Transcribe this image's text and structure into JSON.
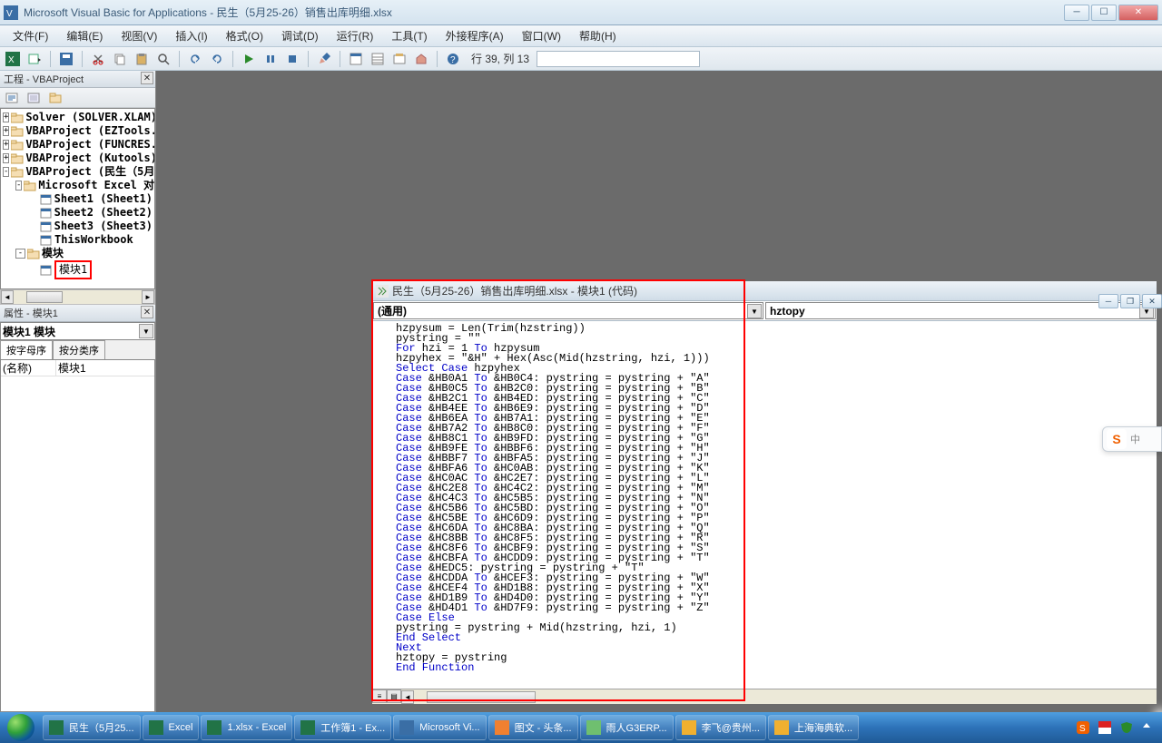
{
  "title": "Microsoft Visual Basic for Applications - 民生（5月25-26）销售出库明细.xlsx",
  "menus": [
    "文件(F)",
    "编辑(E)",
    "视图(V)",
    "插入(I)",
    "格式(O)",
    "调试(D)",
    "运行(R)",
    "工具(T)",
    "外接程序(A)",
    "窗口(W)",
    "帮助(H)"
  ],
  "cursorpos": "行 39, 列 13",
  "project_panel_title": "工程 - VBAProject",
  "tree": [
    {
      "lvl": 0,
      "toggle": "+",
      "label": "Solver (SOLVER.XLAM)"
    },
    {
      "lvl": 0,
      "toggle": "+",
      "label": "VBAProject (EZTools."
    },
    {
      "lvl": 0,
      "toggle": "+",
      "label": "VBAProject (FUNCRES."
    },
    {
      "lvl": 0,
      "toggle": "+",
      "label": "VBAProject (Kutools)"
    },
    {
      "lvl": 0,
      "toggle": "-",
      "label": "VBAProject (民生（5月"
    },
    {
      "lvl": 1,
      "toggle": "-",
      "label": "Microsoft Excel 对象"
    },
    {
      "lvl": 2,
      "toggle": "",
      "label": "Sheet1 (Sheet1)"
    },
    {
      "lvl": 2,
      "toggle": "",
      "label": "Sheet2 (Sheet2)"
    },
    {
      "lvl": 2,
      "toggle": "",
      "label": "Sheet3 (Sheet3)"
    },
    {
      "lvl": 2,
      "toggle": "",
      "label": "ThisWorkbook"
    },
    {
      "lvl": 1,
      "toggle": "-",
      "label": "模块"
    },
    {
      "lvl": 2,
      "toggle": "",
      "label": "模块1",
      "hl": true
    }
  ],
  "props_panel_title": "属性 - 模块1",
  "props_dd": "模块1 模块",
  "props_tabs": [
    "按字母序",
    "按分类序"
  ],
  "prop_row": {
    "k": "(名称)",
    "v": "模块1"
  },
  "codewin_title": "民生（5月25-26）销售出库明细.xlsx - 模块1 (代码)",
  "combo_left": "(通用)",
  "combo_right": "hztopy",
  "code_lines": [
    {
      "t": "hzpysum = Len(Trim(hzstring))"
    },
    {
      "t": "pystring = \"\""
    },
    {
      "k": "For",
      "t": " hzi = 1 ",
      "k2": "To",
      "t2": " hzpysum"
    },
    {
      "t": "hzpyhex = \"&H\" + Hex(Asc(Mid(hzstring, hzi, 1)))"
    },
    {
      "k": "Select Case",
      "t": " hzpyhex"
    },
    {
      "k": "Case",
      "t": " &HB0A1 ",
      "k2": "To",
      "t2": " &HB0C4: pystring = pystring + \"A\""
    },
    {
      "k": "Case",
      "t": " &HB0C5 ",
      "k2": "To",
      "t2": " &HB2C0: pystring = pystring + \"B\""
    },
    {
      "k": "Case",
      "t": " &HB2C1 ",
      "k2": "To",
      "t2": " &HB4ED: pystring = pystring + \"C\""
    },
    {
      "k": "Case",
      "t": " &HB4EE ",
      "k2": "To",
      "t2": " &HB6E9: pystring = pystring + \"D\""
    },
    {
      "k": "Case",
      "t": " &HB6EA ",
      "k2": "To",
      "t2": " &HB7A1: pystring = pystring + \"E\""
    },
    {
      "k": "Case",
      "t": " &HB7A2 ",
      "k2": "To",
      "t2": " &HB8C0: pystring = pystring + \"F\""
    },
    {
      "k": "Case",
      "t": " &HB8C1 ",
      "k2": "To",
      "t2": " &HB9FD: pystring = pystring + \"G\""
    },
    {
      "k": "Case",
      "t": " &HB9FE ",
      "k2": "To",
      "t2": " &HBBF6: pystring = pystring + \"H\""
    },
    {
      "k": "Case",
      "t": " &HBBF7 ",
      "k2": "To",
      "t2": " &HBFA5: pystring = pystring + \"J\""
    },
    {
      "k": "Case",
      "t": " &HBFA6 ",
      "k2": "To",
      "t2": " &HC0AB: pystring = pystring + \"K\""
    },
    {
      "k": "Case",
      "t": " &HC0AC ",
      "k2": "To",
      "t2": " &HC2E7: pystring = pystring + \"L\""
    },
    {
      "k": "Case",
      "t": " &HC2E8 ",
      "k2": "To",
      "t2": " &HC4C2: pystring = pystring + \"M\""
    },
    {
      "k": "Case",
      "t": " &HC4C3 ",
      "k2": "To",
      "t2": " &HC5B5: pystring = pystring + \"N\""
    },
    {
      "k": "Case",
      "t": " &HC5B6 ",
      "k2": "To",
      "t2": " &HC5BD: pystring = pystring + \"O\""
    },
    {
      "k": "Case",
      "t": " &HC5BE ",
      "k2": "To",
      "t2": " &HC6D9: pystring = pystring + \"P\""
    },
    {
      "k": "Case",
      "t": " &HC6DA ",
      "k2": "To",
      "t2": " &HC8BA: pystring = pystring + \"Q\""
    },
    {
      "k": "Case",
      "t": " &HC8BB ",
      "k2": "To",
      "t2": " &HC8F5: pystring = pystring + \"R\""
    },
    {
      "k": "Case",
      "t": " &HC8F6 ",
      "k2": "To",
      "t2": " &HCBF9: pystring = pystring + \"S\""
    },
    {
      "k": "Case",
      "t": " &HCBFA ",
      "k2": "To",
      "t2": " &HCDD9: pystring = pystring + \"T\""
    },
    {
      "k": "Case",
      "t": " &HEDC5: pystring = pystring + \"T\""
    },
    {
      "k": "Case",
      "t": " &HCDDA ",
      "k2": "To",
      "t2": " &HCEF3: pystring = pystring + \"W\""
    },
    {
      "k": "Case",
      "t": " &HCEF4 ",
      "k2": "To",
      "t2": " &HD1B8: pystring = pystring + \"X\""
    },
    {
      "k": "Case",
      "t": " &HD1B9 ",
      "k2": "To",
      "t2": " &HD4D0: pystring = pystring + \"Y\""
    },
    {
      "k": "Case",
      "t": " &HD4D1 ",
      "k2": "To",
      "t2": " &HD7F9: pystring = pystring + \"Z\""
    },
    {
      "k": "Case Else"
    },
    {
      "t": "pystring = pystring + Mid(hzstring, hzi, 1)"
    },
    {
      "k": "End Select"
    },
    {
      "k": "Next"
    },
    {
      "t": "hztopy = pystring"
    },
    {
      "k": "End Function"
    }
  ],
  "ime_label": "中",
  "taskbar": [
    {
      "label": "民生（5月25...",
      "color": "#217346"
    },
    {
      "label": "Excel",
      "color": "#217346"
    },
    {
      "label": "1.xlsx - Excel",
      "color": "#217346"
    },
    {
      "label": "工作簿1 - Ex...",
      "color": "#217346"
    },
    {
      "label": "Microsoft Vi...",
      "color": "#3a6ea5"
    },
    {
      "label": "图文 - 头条...",
      "color": "#f08030"
    },
    {
      "label": "雨人G3ERP...",
      "color": "#6fbf6f"
    },
    {
      "label": "李飞@贵州...",
      "color": "#f0b030"
    },
    {
      "label": "上海海典软...",
      "color": "#f0b030"
    }
  ]
}
